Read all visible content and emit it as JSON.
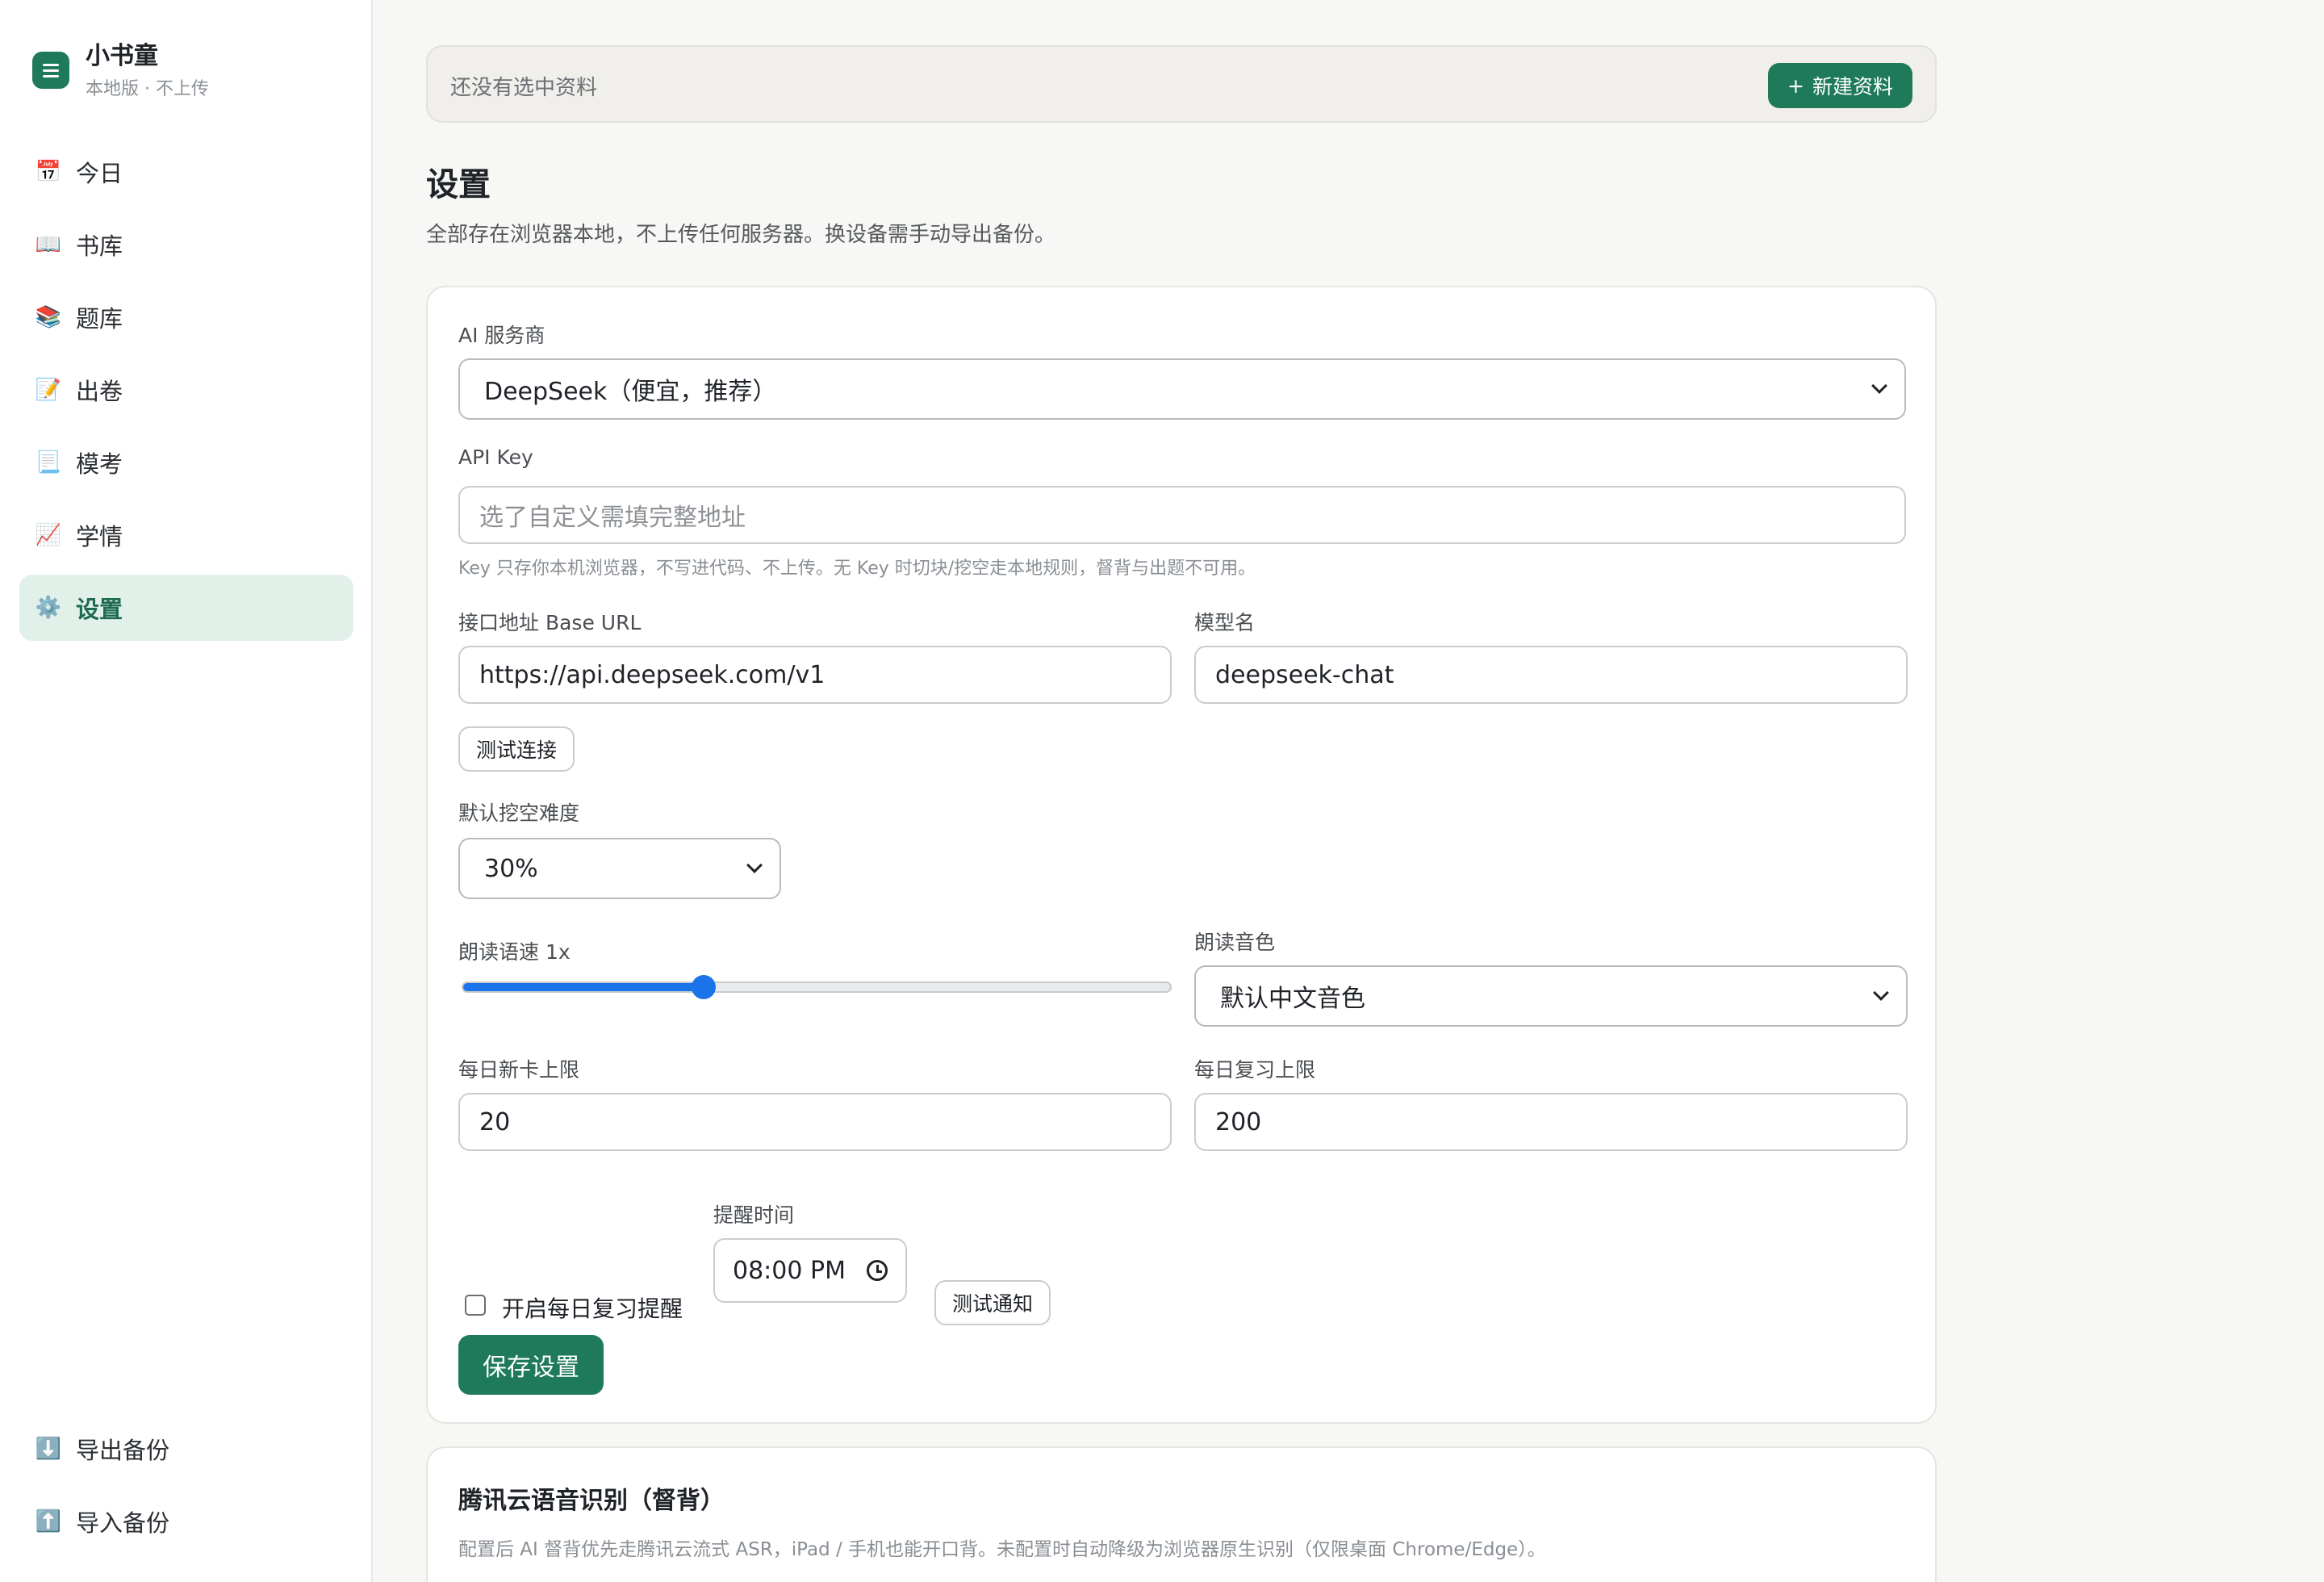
{
  "brand": {
    "title": "小书童",
    "subtitle": "本地版 · 不上传"
  },
  "nav": [
    {
      "icon": "📅",
      "icon_name": "calendar-icon",
      "label": "今日"
    },
    {
      "icon": "📖",
      "icon_name": "book-icon",
      "label": "书库"
    },
    {
      "icon": "📚",
      "icon_name": "books-icon",
      "label": "题库"
    },
    {
      "icon": "📝",
      "icon_name": "memo-icon",
      "label": "出卷"
    },
    {
      "icon": "📃",
      "icon_name": "page-icon",
      "label": "模考"
    },
    {
      "icon": "📈",
      "icon_name": "chart-icon",
      "label": "学情"
    },
    {
      "icon": "⚙️",
      "icon_name": "gear-icon",
      "label": "设置",
      "active": true
    }
  ],
  "nav_bottom": [
    {
      "icon": "⬇️",
      "icon_name": "download-icon",
      "label": "导出备份"
    },
    {
      "icon": "⬆️",
      "icon_name": "upload-icon",
      "label": "导入备份"
    }
  ],
  "topbar": {
    "status": "还没有选中资料",
    "new_button": "新建资料",
    "new_icon": "+"
  },
  "page": {
    "title": "设置",
    "description": "全部存在浏览器本地，不上传任何服务器。换设备需手动导出备份。"
  },
  "settings": {
    "provider_label": "AI 服务商",
    "provider_value": "DeepSeek（便宜，推荐）",
    "apikey_label": "API Key",
    "apikey_placeholder": "选了自定义需填完整地址",
    "apikey_hint": "Key 只存你本机浏览器，不写进代码、不上传。无 Key 时切块/挖空走本地规则，督背与出题不可用。",
    "baseurl_label": "接口地址 Base URL",
    "baseurl_value": "https://api.deepseek.com/v1",
    "model_label": "模型名",
    "model_value": "deepseek-chat",
    "test_connection": "测试连接",
    "difficulty_label": "默认挖空难度",
    "difficulty_value": "30%",
    "speed_label": "朗读语速 1x",
    "speed_fraction": 0.34,
    "voice_label": "朗读音色",
    "voice_value": "默认中文音色",
    "daily_new_label": "每日新卡上限",
    "daily_new_value": "20",
    "daily_review_label": "每日复习上限",
    "daily_review_value": "200",
    "reminder_checkbox_label": "开启每日复习提醒",
    "reminder_checked": false,
    "reminder_time_label": "提醒时间",
    "reminder_time_value": "08:00 PM",
    "test_notify": "测试通知",
    "save_button": "保存设置"
  },
  "asr": {
    "title": "腾讯云语音识别（督背）",
    "description": "配置后 AI 督背优先走腾讯云流式 ASR，iPad / 手机也能开口背。未配置时自动降级为浏览器原生识别（仅限桌面 Chrome/Edge）。"
  },
  "colors": {
    "accent": "#1e7a5a",
    "active_bg": "#e2f0ea",
    "slider": "#1a73e8"
  }
}
